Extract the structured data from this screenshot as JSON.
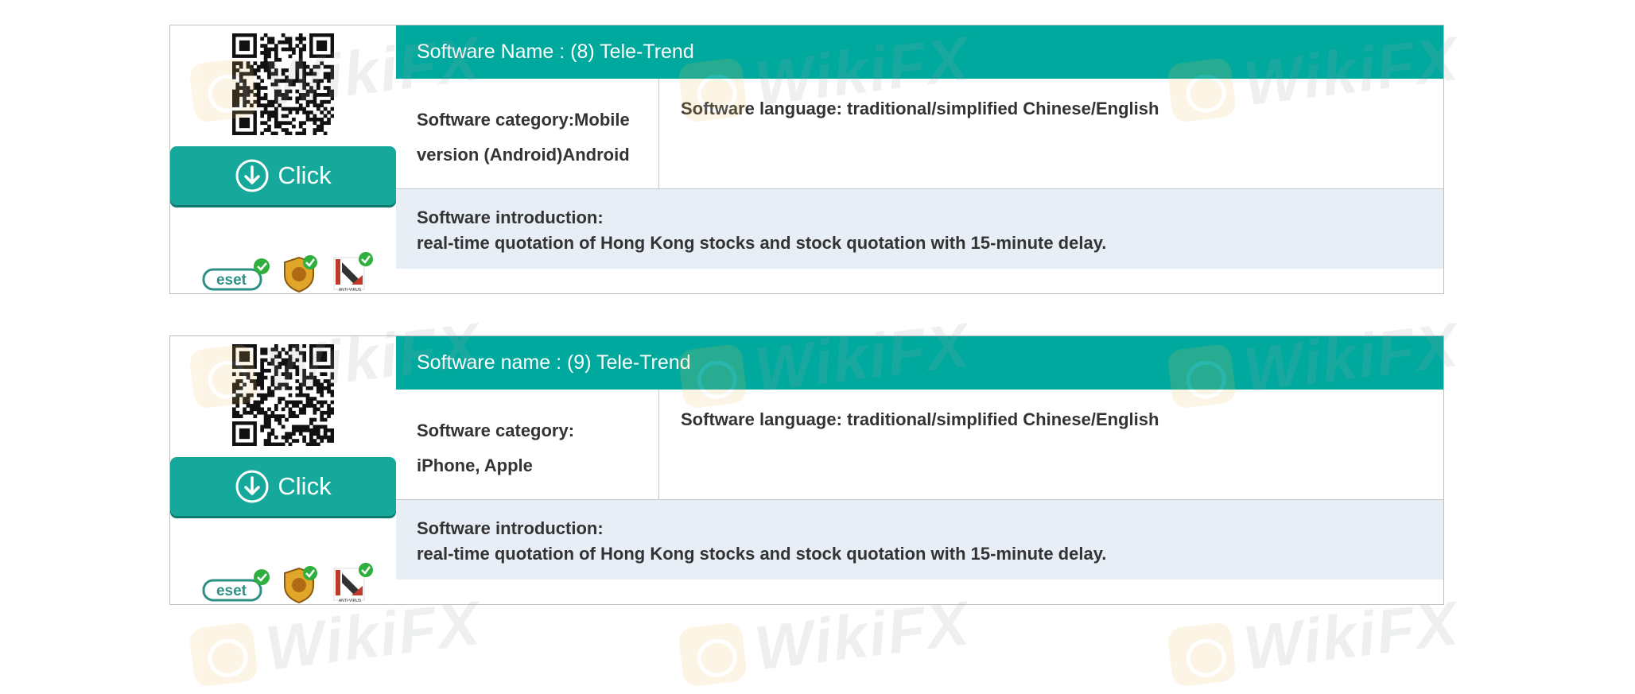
{
  "watermark": {
    "text": "WikiFX"
  },
  "cards": [
    {
      "header": "Software Name : (8) Tele-Trend",
      "download_label": "Click",
      "category_line1": "Software category:Mobile",
      "category_line2": "version (Android)Android",
      "language": "Software language: traditional/simplified Chinese/English",
      "intro_label": "Software introduction:",
      "intro_text": "real-time quotation of Hong Kong stocks and stock quotation with 15-minute delay."
    },
    {
      "header": "Software name : (9) Tele-Trend",
      "download_label": "Click",
      "category_line1": "Software category:",
      "category_line2": "iPhone, Apple",
      "language": "Software language: traditional/simplified Chinese/English",
      "intro_label": "Software introduction:",
      "intro_text": "real-time quotation of Hong Kong stocks and stock quotation with 15-minute delay."
    }
  ],
  "security_badges": [
    {
      "name": "eset",
      "text": "eset"
    },
    {
      "name": "shield-lion"
    },
    {
      "name": "kaspersky",
      "text": "ANTI-VIRUS"
    }
  ],
  "colors": {
    "header_bg": "#00a99d",
    "button_bg": "#16a99b",
    "intro_bg": "#e8eef6",
    "check_green": "#2eaf3e",
    "watermark_badge": "#f0c060"
  },
  "icons": {
    "qr": "qr-code-icon",
    "download": "download-arrow-icon",
    "check": "check-badge-icon"
  }
}
